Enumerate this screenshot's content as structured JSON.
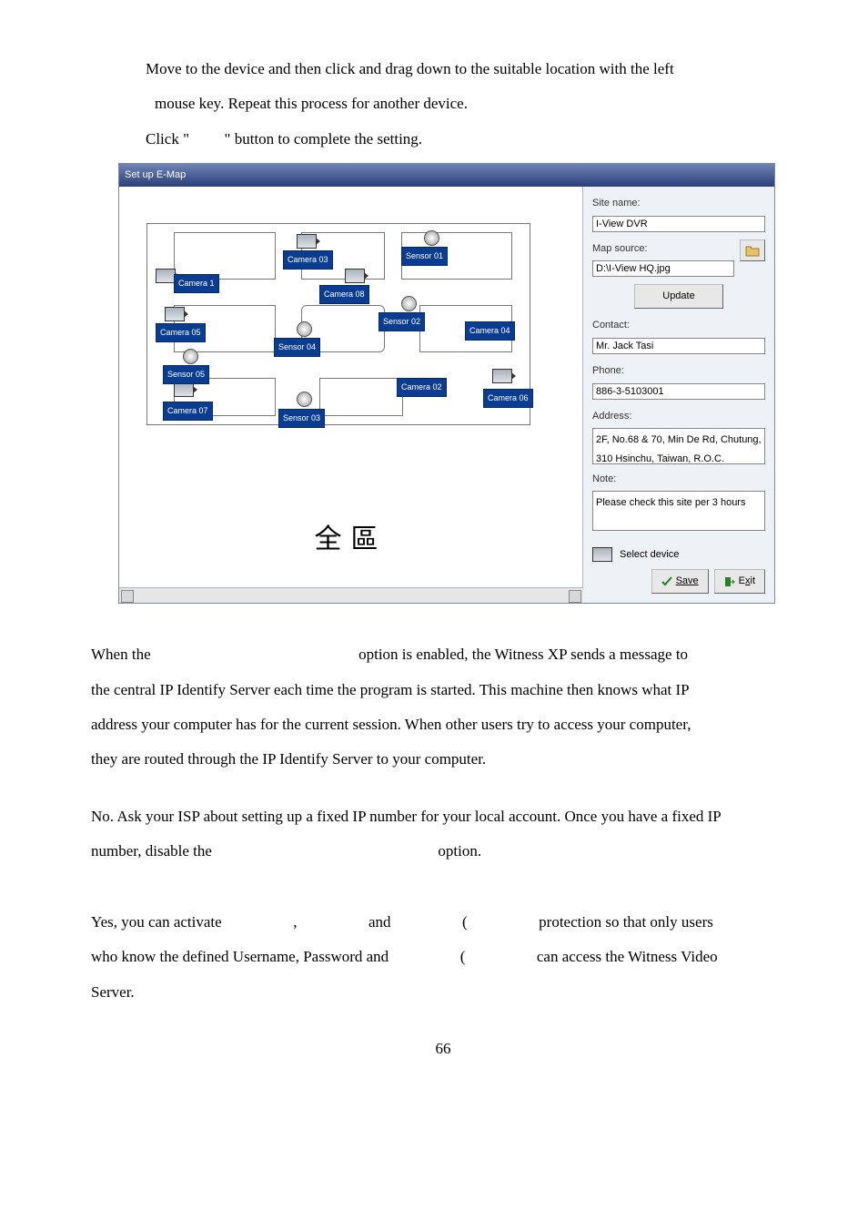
{
  "instructions": {
    "line1": "Move to the device and then click and drag down to the suitable location with the left",
    "line2": "mouse key.    Repeat this process for another device.",
    "line3a": "Click \"",
    "line3b": "\" button to complete the setting."
  },
  "emap": {
    "title": "Set up E-Map",
    "canvas": {
      "labels": {
        "camera1": "Camera 1",
        "camera02": "Camera 02",
        "camera03": "Camera 03",
        "camera04": "Camera 04",
        "camera05": "Camera 05",
        "camera06": "Camera 06",
        "camera07": "Camera 07",
        "camera08": "Camera 08",
        "sensor01": "Sensor 01",
        "sensor02": "Sensor 02",
        "sensor03": "Sensor 03",
        "sensor04": "Sensor 04",
        "sensor05": "Sensor 05"
      },
      "bigtext": "全區"
    },
    "side": {
      "site_name_label": "Site name:",
      "site_name_value": "I-View DVR",
      "map_source_label": "Map source:",
      "map_source_value": "D:\\I-View HQ.jpg",
      "update_btn": "Update",
      "contact_label": "Contact:",
      "contact_value": "Mr. Jack Tasi",
      "phone_label": "Phone:",
      "phone_value": "886-3-5103001",
      "address_label": "Address:",
      "address_value": "2F, No.68 & 70, Min De Rd, Chutung, 310 Hsinchu, Taiwan, R.O.C.",
      "note_label": "Note:",
      "note_value": "Please check this site per 3 hours",
      "select_device": "Select device",
      "save_btn": "Save",
      "exit_btn": "Exit"
    }
  },
  "body": {
    "p1a": "When the ",
    "p1b": " option is enabled, the Witness XP sends a message to",
    "p2": "the central IP Identify Server each time the program is started.    This machine then knows what IP",
    "p3": "address your computer has for the current session.    When other users try to access your computer,",
    "p4": "they are routed through the IP Identify Server to your computer.",
    "p5": "No. Ask your ISP about setting up a fixed IP number for your local account.    Once you have a fixed IP",
    "p6a": "number, disable the ",
    "p6b": " option.",
    "p7a": "Yes, you can activate",
    "p7b": ",",
    "p7c": "and",
    "p7d": "(",
    "p7e": "protection so that only users",
    "p8a": "who know the defined Username, Password and",
    "p8b": "(",
    "p8c": "can access the Witness Video",
    "p9": "Server."
  },
  "page_num": "66"
}
